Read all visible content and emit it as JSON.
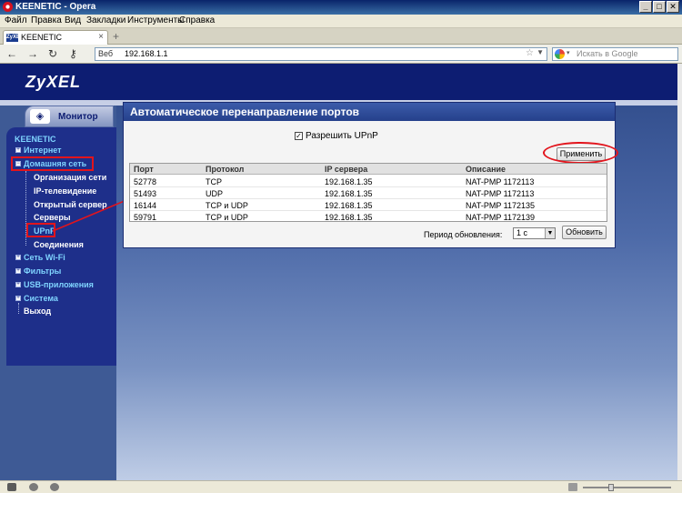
{
  "window": {
    "title": "KEENETIC - Opera",
    "controls": [
      "_",
      "□",
      "✕"
    ]
  },
  "menu": [
    "Файл",
    "Правка",
    "Вид",
    "Закладки",
    "Инструменты",
    "Справка"
  ],
  "tab": {
    "favicon": "ZyXEL",
    "label": "KEENETIC",
    "close": "×",
    "new_tab": "+"
  },
  "address": {
    "prefix": "Веб",
    "url": "192.168.1.1",
    "bookmark_icon": "star-icon"
  },
  "search": {
    "placeholder": "Искать в Google",
    "engine_icon": "google-icon"
  },
  "page": {
    "brand": "ZyXEL",
    "monitor_label": "Монитор",
    "sidebar": {
      "root": "KEENETIC",
      "items": [
        {
          "label": "Интернет",
          "marker": "+"
        },
        {
          "label": "Домашняя сеть",
          "marker": "−"
        },
        {
          "label": "Организация сети"
        },
        {
          "label": "IP-телевидение"
        },
        {
          "label": "Открытый сервер"
        },
        {
          "label": "Серверы"
        },
        {
          "label": "UPnP"
        },
        {
          "label": "Соединения"
        },
        {
          "label": "Сеть Wi-Fi",
          "marker": "+"
        },
        {
          "label": "Фильтры",
          "marker": "+"
        },
        {
          "label": "USB-приложения",
          "marker": "+"
        },
        {
          "label": "Система",
          "marker": "+"
        },
        {
          "label": "Выход"
        }
      ]
    },
    "panel": {
      "title": "Автоматическое перенаправление портов",
      "upnp_checkbox": {
        "label": "Разрешить UPnP",
        "checked": true,
        "mark": "✓"
      },
      "apply_button": "Применить",
      "columns": [
        "Порт",
        "Протокол",
        "IP сервера",
        "Описание"
      ],
      "rows": [
        [
          "52778",
          "TCP",
          "192.168.1.35",
          "NAT-PMP 1172113"
        ],
        [
          "51493",
          "UDP",
          "192.168.1.35",
          "NAT-PMP 1172113"
        ],
        [
          "16144",
          "TCP и UDP",
          "192.168.1.35",
          "NAT-PMP 1172135"
        ],
        [
          "59791",
          "TCP и UDP",
          "192.168.1.35",
          "NAT-PMP 1172139"
        ]
      ],
      "refresh_label": "Период обновления:",
      "refresh_value": "1 с",
      "refresh_button": "Обновить"
    }
  },
  "colors": {
    "highlight": "#e2141c",
    "header": "#0d1d72",
    "sidebar": "#1e2f8a",
    "sidebar_link": "#7fd4ff"
  }
}
